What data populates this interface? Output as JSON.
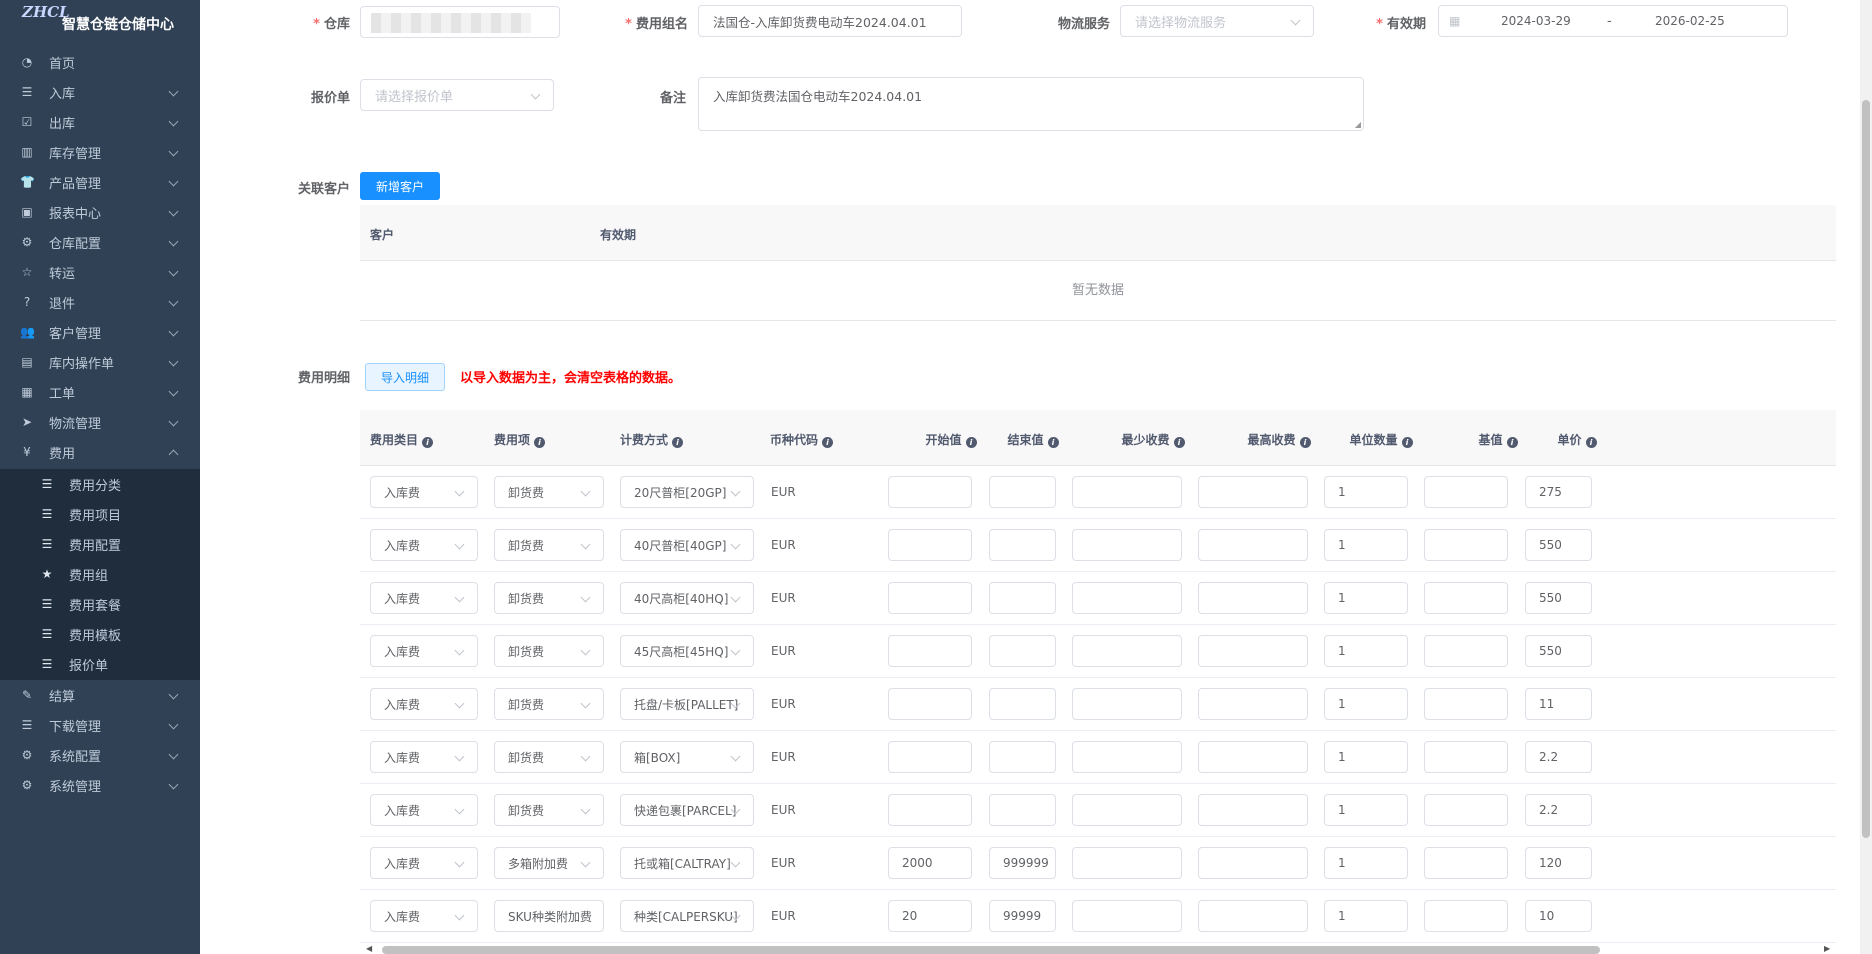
{
  "app": {
    "title": "智慧仓链仓储中心",
    "logo_text": "ZHCL"
  },
  "sidebar": {
    "items": [
      {
        "label": "首页",
        "icon": "dashboard-icon",
        "glyph": "◔",
        "has_children": false
      },
      {
        "label": "入库",
        "icon": "list-icon",
        "glyph": "☰",
        "has_children": true
      },
      {
        "label": "出库",
        "icon": "checkbox-icon",
        "glyph": "☑",
        "has_children": true
      },
      {
        "label": "库存管理",
        "icon": "chart-icon",
        "glyph": "▥",
        "has_children": true
      },
      {
        "label": "产品管理",
        "icon": "shirt-icon",
        "glyph": "👕",
        "has_children": true
      },
      {
        "label": "报表中心",
        "icon": "report-icon",
        "glyph": "▣",
        "has_children": true
      },
      {
        "label": "仓库配置",
        "icon": "gear-icon",
        "glyph": "⚙",
        "has_children": true
      },
      {
        "label": "转运",
        "icon": "star-icon",
        "glyph": "☆",
        "has_children": true
      },
      {
        "label": "退件",
        "icon": "question-icon",
        "glyph": "?",
        "has_children": true
      },
      {
        "label": "客户管理",
        "icon": "users-icon",
        "glyph": "👥",
        "has_children": true
      },
      {
        "label": "库内操作单",
        "icon": "document-icon",
        "glyph": "▤",
        "has_children": true
      },
      {
        "label": "工单",
        "icon": "table-icon",
        "glyph": "▦",
        "has_children": true
      },
      {
        "label": "物流管理",
        "icon": "send-icon",
        "glyph": "➤",
        "has_children": true
      },
      {
        "label": "费用",
        "icon": "yen-icon",
        "glyph": "¥",
        "has_children": true,
        "expanded": true
      }
    ],
    "submenu": [
      {
        "label": "费用分类",
        "icon": "list-icon",
        "glyph": "☰"
      },
      {
        "label": "费用项目",
        "icon": "list-icon",
        "glyph": "☰"
      },
      {
        "label": "费用配置",
        "icon": "list-icon",
        "glyph": "☰"
      },
      {
        "label": "费用组",
        "icon": "star-filled-icon",
        "glyph": "★"
      },
      {
        "label": "费用套餐",
        "icon": "list-icon",
        "glyph": "☰"
      },
      {
        "label": "费用模板",
        "icon": "list-icon",
        "glyph": "☰"
      },
      {
        "label": "报价单",
        "icon": "list-icon",
        "glyph": "☰"
      }
    ],
    "items_after": [
      {
        "label": "结算",
        "icon": "edit-icon",
        "glyph": "✎",
        "has_children": true
      },
      {
        "label": "下载管理",
        "icon": "list-icon",
        "glyph": "☰",
        "has_children": true
      },
      {
        "label": "系统配置",
        "icon": "gear-icon",
        "glyph": "⚙",
        "has_children": true
      },
      {
        "label": "系统管理",
        "icon": "gear-icon",
        "glyph": "⚙",
        "has_children": true
      }
    ]
  },
  "form": {
    "warehouse": {
      "label": "仓库",
      "value": ""
    },
    "fee_group_name": {
      "label": "费用组名",
      "value": "法国仓-入库卸货费电动车2024.04.01"
    },
    "logistics": {
      "label": "物流服务",
      "placeholder": "请选择物流服务"
    },
    "validity": {
      "label": "有效期",
      "start": "2024-03-29",
      "separator": "-",
      "end": "2026-02-25"
    },
    "quote": {
      "label": "报价单",
      "placeholder": "请选择报价单"
    },
    "remark": {
      "label": "备注",
      "value": "入库卸货费法国仓电动车2024.04.01"
    }
  },
  "customers": {
    "label": "关联客户",
    "add_button": "新增客户",
    "columns": [
      "客户",
      "有效期"
    ],
    "empty_text": "暂无数据"
  },
  "fee_detail": {
    "label": "费用明细",
    "import_button": "导入明细",
    "warning": "以导入数据为主，会清空表格的数据。",
    "columns": [
      "费用类目",
      "费用项",
      "计费方式",
      "币种代码",
      "开始值",
      "结束值",
      "最少收费",
      "最高收费",
      "单位数量",
      "基值",
      "单价"
    ],
    "rows": [
      {
        "category": "入库费",
        "item": "卸货费",
        "method": "20尺普柜[20GP]",
        "currency": "EUR",
        "start": "",
        "end": "",
        "min": "",
        "max": "",
        "qty": "1",
        "base": "",
        "price": "275"
      },
      {
        "category": "入库费",
        "item": "卸货费",
        "method": "40尺普柜[40GP]",
        "currency": "EUR",
        "start": "",
        "end": "",
        "min": "",
        "max": "",
        "qty": "1",
        "base": "",
        "price": "550"
      },
      {
        "category": "入库费",
        "item": "卸货费",
        "method": "40尺高柜[40HQ]",
        "currency": "EUR",
        "start": "",
        "end": "",
        "min": "",
        "max": "",
        "qty": "1",
        "base": "",
        "price": "550"
      },
      {
        "category": "入库费",
        "item": "卸货费",
        "method": "45尺高柜[45HQ]",
        "currency": "EUR",
        "start": "",
        "end": "",
        "min": "",
        "max": "",
        "qty": "1",
        "base": "",
        "price": "550"
      },
      {
        "category": "入库费",
        "item": "卸货费",
        "method": "托盘/卡板[PALLET]",
        "currency": "EUR",
        "start": "",
        "end": "",
        "min": "",
        "max": "",
        "qty": "1",
        "base": "",
        "price": "11"
      },
      {
        "category": "入库费",
        "item": "卸货费",
        "method": "箱[BOX]",
        "currency": "EUR",
        "start": "",
        "end": "",
        "min": "",
        "max": "",
        "qty": "1",
        "base": "",
        "price": "2.2"
      },
      {
        "category": "入库费",
        "item": "卸货费",
        "method": "快递包裹[PARCEL]",
        "currency": "EUR",
        "start": "",
        "end": "",
        "min": "",
        "max": "",
        "qty": "1",
        "base": "",
        "price": "2.2"
      },
      {
        "category": "入库费",
        "item": "多箱附加费",
        "method": "托或箱[CALTRAY]",
        "currency": "EUR",
        "start": "2000",
        "end": "999999",
        "min": "",
        "max": "",
        "qty": "1",
        "base": "",
        "price": "120"
      },
      {
        "category": "入库费",
        "item": "SKU种类附加费",
        "method": "种类[CALPERSKU]",
        "currency": "EUR",
        "start": "20",
        "end": "99999",
        "min": "",
        "max": "",
        "qty": "1",
        "base": "",
        "price": "10"
      }
    ]
  },
  "colors": {
    "primary": "#1890ff",
    "sidebar_bg": "#304156",
    "submenu_bg": "#1f2d3d",
    "warning": "#ff0000",
    "required": "#f56c6c"
  }
}
